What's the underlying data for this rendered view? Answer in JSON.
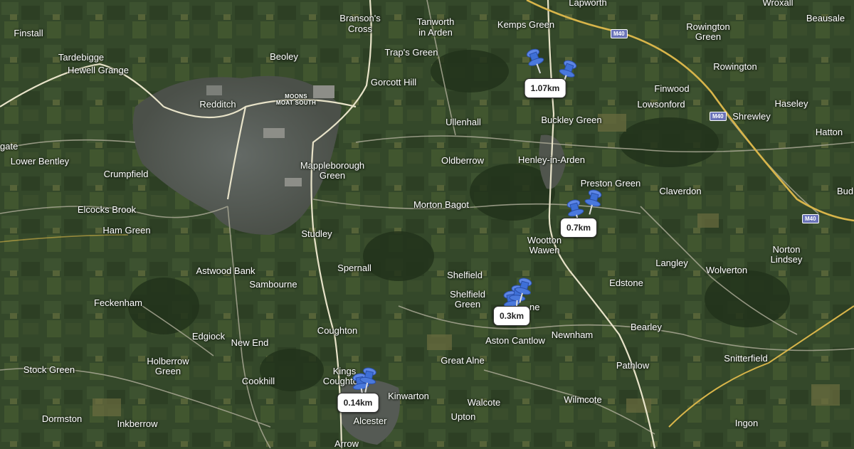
{
  "map": {
    "colors": {
      "terrain": "#34482a",
      "urban": "#5a5f5c",
      "roads": "#b9b7a3",
      "motorway": "#d8b54a",
      "label": "#ffffff",
      "pin": "#3e6fd6"
    },
    "places": [
      {
        "id": "finstall",
        "name": "Finstall"
      },
      {
        "id": "tardebigge",
        "name": "Tardebigge"
      },
      {
        "id": "hewell-grange",
        "name": "Hewell Grange"
      },
      {
        "id": "beoley",
        "name": "Beoley"
      },
      {
        "id": "bransons-cross-1",
        "name": "Branson's"
      },
      {
        "id": "bransons-cross-2",
        "name": "Cross"
      },
      {
        "id": "tanworth-1",
        "name": "Tanworth"
      },
      {
        "id": "tanworth-2",
        "name": "in Arden"
      },
      {
        "id": "kemps-green",
        "name": "Kemps Green"
      },
      {
        "id": "lapworth",
        "name": "Lapworth"
      },
      {
        "id": "wroxall",
        "name": "Wroxall"
      },
      {
        "id": "beausale",
        "name": "Beausale"
      },
      {
        "id": "rowington-green-1",
        "name": "Rowington"
      },
      {
        "id": "rowington-green-2",
        "name": "Green"
      },
      {
        "id": "rowington",
        "name": "Rowington"
      },
      {
        "id": "traps-green",
        "name": "Trap's Green"
      },
      {
        "id": "gorcott-hill",
        "name": "Gorcott Hill"
      },
      {
        "id": "redditch",
        "name": "Redditch"
      },
      {
        "id": "moons-moat-1",
        "name": "MOONS"
      },
      {
        "id": "moons-moat-2",
        "name": "MOAT SOUTH"
      },
      {
        "id": "finwood",
        "name": "Finwood"
      },
      {
        "id": "lowsonford",
        "name": "Lowsonford"
      },
      {
        "id": "haseley",
        "name": "Haseley"
      },
      {
        "id": "shrewley",
        "name": "Shrewley"
      },
      {
        "id": "hatton",
        "name": "Hatton"
      },
      {
        "id": "ullenhall",
        "name": "Ullenhall"
      },
      {
        "id": "buckley-green",
        "name": "Buckley Green"
      },
      {
        "id": "gate",
        "name": "gate"
      },
      {
        "id": "lower-bentley",
        "name": "Lower Bentley"
      },
      {
        "id": "oldberrow",
        "name": "Oldberrow"
      },
      {
        "id": "henley-in-arden",
        "name": "Henley-in-Arden"
      },
      {
        "id": "mappleborough-1",
        "name": "Mappleborough"
      },
      {
        "id": "mappleborough-2",
        "name": "Green"
      },
      {
        "id": "crumpfield",
        "name": "Crumpfield"
      },
      {
        "id": "preston-green",
        "name": "Preston Green"
      },
      {
        "id": "claverdon",
        "name": "Claverdon"
      },
      {
        "id": "bud",
        "name": "Bud"
      },
      {
        "id": "morton-bagot",
        "name": "Morton Bagot"
      },
      {
        "id": "elcocks-brook",
        "name": "Elcocks Brook"
      },
      {
        "id": "ham-green",
        "name": "Ham Green"
      },
      {
        "id": "studley",
        "name": "Studley"
      },
      {
        "id": "wootton-wawen-1",
        "name": "Wootton"
      },
      {
        "id": "wootton-wawen-2",
        "name": "Wawen"
      },
      {
        "id": "norton-lindsey-1",
        "name": "Norton"
      },
      {
        "id": "norton-lindsey-2",
        "name": "Lindsey"
      },
      {
        "id": "langley",
        "name": "Langley"
      },
      {
        "id": "wolverton",
        "name": "Wolverton"
      },
      {
        "id": "spernall",
        "name": "Spernall"
      },
      {
        "id": "astwood-bank",
        "name": "Astwood Bank"
      },
      {
        "id": "shelfield",
        "name": "Shelfield"
      },
      {
        "id": "sambourne",
        "name": "Sambourne"
      },
      {
        "id": "edstone",
        "name": "Edstone"
      },
      {
        "id": "shelfield-green-1",
        "name": "Shelfield"
      },
      {
        "id": "shelfield-green-2",
        "name": "Green"
      },
      {
        "id": "feckenham",
        "name": "Feckenham"
      },
      {
        "id": "wootton-ne",
        "name": "ne"
      },
      {
        "id": "bearley",
        "name": "Bearley"
      },
      {
        "id": "coughton",
        "name": "Coughton"
      },
      {
        "id": "newnham",
        "name": "Newnham"
      },
      {
        "id": "edgiock",
        "name": "Edgiock"
      },
      {
        "id": "aston-cantlow",
        "name": "Aston Cantlow"
      },
      {
        "id": "new-end",
        "name": "New End"
      },
      {
        "id": "holberrow-1",
        "name": "Holberrow"
      },
      {
        "id": "holberrow-2",
        "name": "Green"
      },
      {
        "id": "great-alne",
        "name": "Great Alne"
      },
      {
        "id": "snitterfield",
        "name": "Snitterfield"
      },
      {
        "id": "pathlow",
        "name": "Pathlow"
      },
      {
        "id": "stock-green",
        "name": "Stock Green"
      },
      {
        "id": "kings-coughton-1",
        "name": "Kings"
      },
      {
        "id": "kings-coughton-2",
        "name": "Coughton"
      },
      {
        "id": "cookhill",
        "name": "Cookhill"
      },
      {
        "id": "kinwarton",
        "name": "Kinwarton"
      },
      {
        "id": "walcote",
        "name": "Walcote"
      },
      {
        "id": "wilmcote",
        "name": "Wilmcote"
      },
      {
        "id": "upton",
        "name": "Upton"
      },
      {
        "id": "dormston",
        "name": "Dormston"
      },
      {
        "id": "inkberrow",
        "name": "Inkberrow"
      },
      {
        "id": "alcester",
        "name": "Alcester"
      },
      {
        "id": "ingon",
        "name": "Ingon"
      },
      {
        "id": "arrow",
        "name": "Arrow"
      }
    ],
    "motorway_shields": [
      {
        "id": "m40-1",
        "label": "M40"
      },
      {
        "id": "m40-2",
        "label": "M40"
      },
      {
        "id": "m40-3",
        "label": "M40"
      }
    ],
    "markers": [
      {
        "id": "marker-1",
        "distance": "1.07km",
        "pins": 2
      },
      {
        "id": "marker-2",
        "distance": "0.7km",
        "pins": 2
      },
      {
        "id": "marker-3",
        "distance": "0.3km",
        "pins": 3
      },
      {
        "id": "marker-4",
        "distance": "0.14km",
        "pins": 2
      }
    ]
  }
}
